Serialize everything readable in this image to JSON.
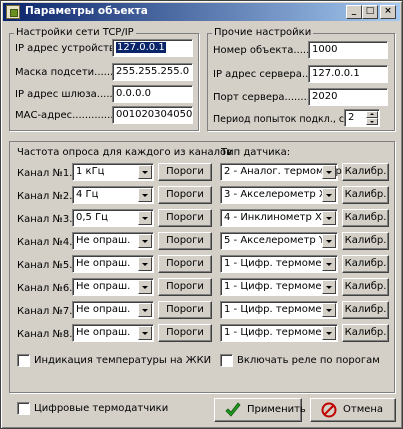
{
  "window": {
    "title": "Параметры объекта",
    "controls": {
      "minimize": "_",
      "maximize": "□",
      "close": "×"
    }
  },
  "network": {
    "group_label": "Настройки сети TCP/IP",
    "ip_label": "IP адрес устройства.......",
    "ip_value": "127.0.0.1",
    "mask_label": "Маска подсети..........",
    "mask_value": "255.255.255.0",
    "gateway_label": "IP адрес шлюза...........",
    "gateway_value": "0.0.0.0",
    "mac_label": "МАС-адрес.....................",
    "mac_value": "001020304050"
  },
  "other": {
    "group_label": "Прочие настройки",
    "object_number_label": "Номер объекта..........",
    "object_number_value": "1000",
    "server_ip_label": "IP адрес сервера........",
    "server_ip_value": "127.0.0.1",
    "server_port_label": "Порт сервера...............",
    "server_port_value": "2020",
    "retry_label": "Период попыток подкл., сек..",
    "retry_value": "2"
  },
  "channels": {
    "freq_header": "Частота опроса для каждого из каналов",
    "type_header": "Тип датчика:",
    "threshold_label": "Пороги",
    "calib_label": "Калибр.",
    "rows": [
      {
        "label": "Канал №1.....",
        "freq": "1 кГц",
        "sensor": "2 - Аналог. термометр"
      },
      {
        "label": "Канал №2.....",
        "freq": "4 Гц",
        "sensor": "3 - Акселерометр X"
      },
      {
        "label": "Канал №3.....",
        "freq": "0,5 Гц",
        "sensor": "4 - Инклинометр X"
      },
      {
        "label": "Канал №4.....",
        "freq": "Не опраш.",
        "sensor": "5 - Акселерометр Y"
      },
      {
        "label": "Канал №5.....",
        "freq": "Не опраш.",
        "sensor": "1 - Цифр. термометр"
      },
      {
        "label": "Канал №6.....",
        "freq": "Не опраш.",
        "sensor": "1 - Цифр. термометр"
      },
      {
        "label": "Канал №7.....",
        "freq": "Не опраш.",
        "sensor": "1 - Цифр. термометр"
      },
      {
        "label": "Канал №8.....",
        "freq": "Не опраш.",
        "sensor": "1 - Цифр. термометр"
      }
    ],
    "lcd_temp_label": "Индикация температуры на ЖКИ",
    "lcd_temp_checked": false,
    "relay_label": "Включать реле по порогам",
    "relay_checked": false
  },
  "footer": {
    "digital_sensors_label": "Цифровые термодатчики",
    "digital_sensors_checked": false,
    "apply_label": "Применить",
    "cancel_label": "Отмена"
  }
}
